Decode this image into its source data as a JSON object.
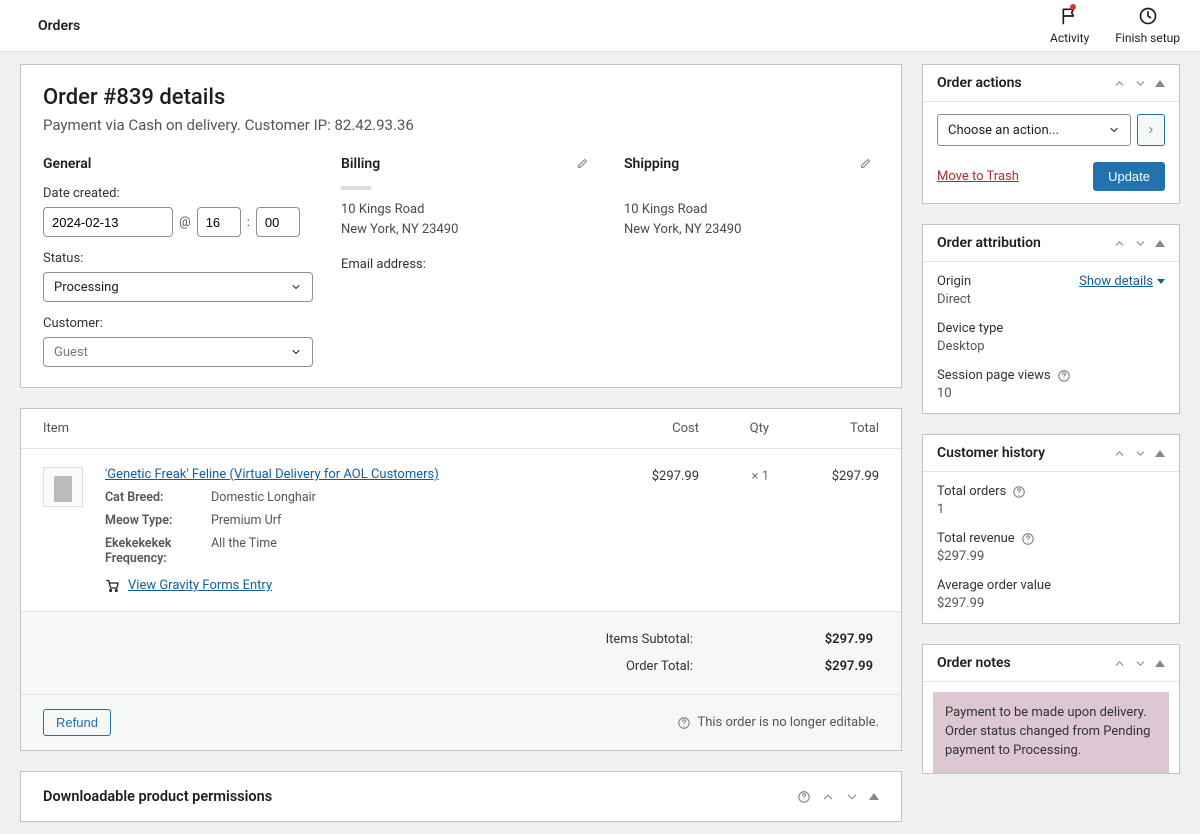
{
  "topbar": {
    "title": "Orders",
    "activity": "Activity",
    "finish_setup": "Finish setup"
  },
  "order": {
    "title": "Order #839 details",
    "subtitle": "Payment via Cash on delivery. Customer IP: 82.42.93.36",
    "general_heading": "General",
    "billing_heading": "Billing",
    "shipping_heading": "Shipping",
    "date_label": "Date created:",
    "date_value": "2024-02-13",
    "hour": "16",
    "minute": "00",
    "status_label": "Status:",
    "status_value": "Processing",
    "customer_label": "Customer:",
    "customer_value": "Guest",
    "billing_address_l1": "10 Kings Road",
    "billing_address_l2": "New York, NY 23490",
    "billing_email_label": "Email address:",
    "shipping_address_l1": "10 Kings Road",
    "shipping_address_l2": "New York, NY 23490"
  },
  "items": {
    "head_item": "Item",
    "head_cost": "Cost",
    "head_qty": "Qty",
    "head_total": "Total",
    "name": "'Genetic Freak' Feline (Virtual Delivery for AOL Customers)",
    "meta": [
      {
        "label": "Cat Breed:",
        "value": "Domestic Longhair"
      },
      {
        "label": "Meow Type:",
        "value": "Premium Urf"
      },
      {
        "label": "Ekekekekek Frequency:",
        "value": "All the Time"
      }
    ],
    "gf_link": "View Gravity Forms Entry",
    "cost": "$297.99",
    "qty": "× 1",
    "total": "$297.99",
    "subtotal_label": "Items Subtotal:",
    "subtotal_val": "$297.99",
    "order_total_label": "Order Total:",
    "order_total_val": "$297.99",
    "refund_btn": "Refund",
    "not_editable": "This order is no longer editable."
  },
  "dpp": {
    "title": "Downloadable product permissions"
  },
  "actions": {
    "title": "Order actions",
    "choose": "Choose an action...",
    "trash": "Move to Trash",
    "update": "Update"
  },
  "attribution": {
    "title": "Order attribution",
    "origin_label": "Origin",
    "origin_val": "Direct",
    "show_details": "Show details",
    "device_label": "Device type",
    "device_val": "Desktop",
    "views_label": "Session page views",
    "views_val": "10"
  },
  "history": {
    "title": "Customer history",
    "total_orders_label": "Total orders",
    "total_orders_val": "1",
    "revenue_label": "Total revenue",
    "revenue_val": "$297.99",
    "avg_label": "Average order value",
    "avg_val": "$297.99"
  },
  "notes": {
    "title": "Order notes",
    "note_text": "Payment to be made upon delivery. Order status changed from Pending payment to Processing."
  }
}
